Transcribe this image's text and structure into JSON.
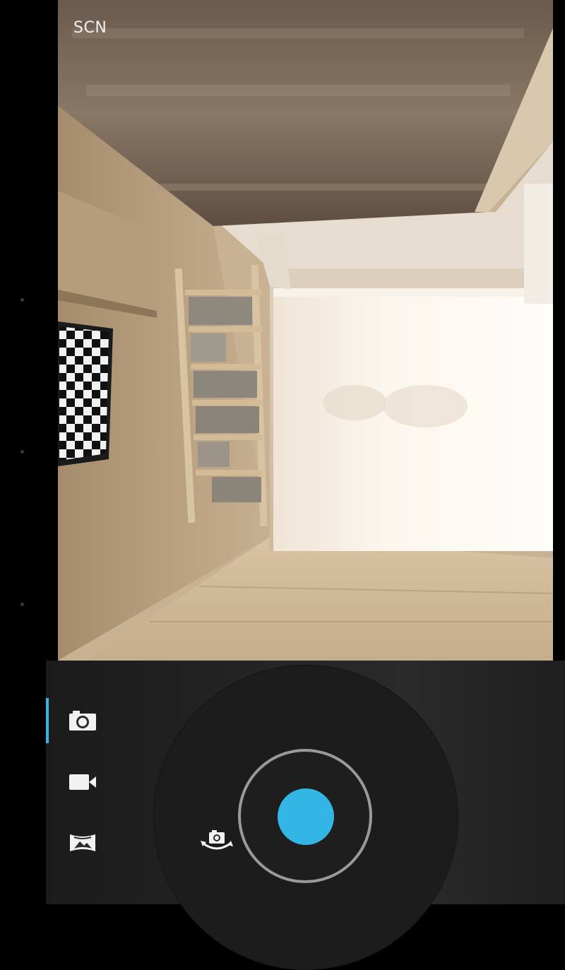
{
  "viewfinder": {
    "scene_mode_label": "SCN"
  },
  "modes": [
    {
      "id": "photo",
      "icon": "camera-icon",
      "selected": true
    },
    {
      "id": "video",
      "icon": "video-camera-icon",
      "selected": false
    },
    {
      "id": "panorama",
      "icon": "panorama-icon",
      "selected": false
    }
  ],
  "controls": {
    "switch_camera_icon": "switch-camera-icon",
    "shutter_icon": "shutter-button"
  },
  "colors": {
    "accent": "#33b5e5",
    "panel": "#222222",
    "dial": "#1c1c1c",
    "ring": "#9a9a9a"
  }
}
